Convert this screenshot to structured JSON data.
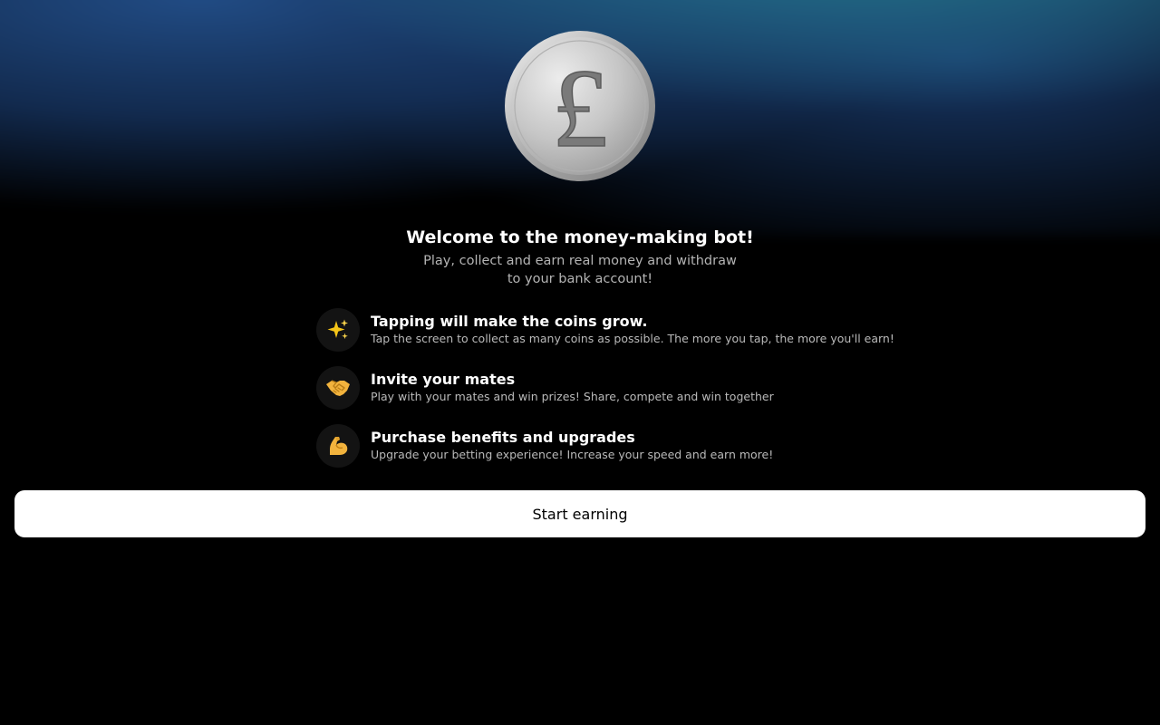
{
  "hero": {
    "coin_symbol": "£",
    "title": "Welcome to the money-making bot!",
    "subtitle": "Play, collect and earn real money and withdraw to your bank account!"
  },
  "features": [
    {
      "icon": "sparkles-icon",
      "title": "Tapping will make the coins grow.",
      "description": "Tap the screen to collect as many coins as possible. The more you tap, the more you'll earn!"
    },
    {
      "icon": "handshake-icon",
      "title": "Invite your mates",
      "description": "Play with your mates and win prizes! Share, compete and win together"
    },
    {
      "icon": "flexed-biceps-icon",
      "title": "Purchase benefits and upgrades",
      "description": "Upgrade your betting experience! Increase your speed and earn more!"
    }
  ],
  "cta": {
    "label": "Start earning"
  },
  "colors": {
    "background": "#000000",
    "glow_teal": "#268c96",
    "glow_blue": "#23508c",
    "button_bg": "#ffffff",
    "coin_silver": "#c8c8c8"
  }
}
